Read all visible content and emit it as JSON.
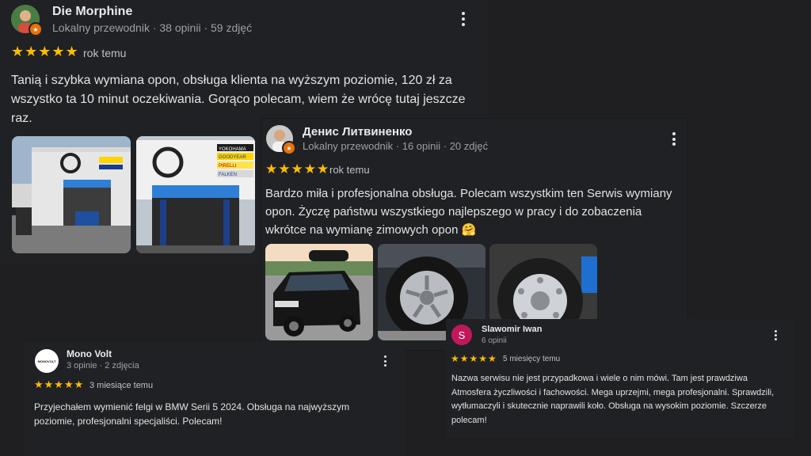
{
  "reviews": [
    {
      "name": "Die Morphine",
      "meta": "Lokalny przewodnik · 38 opinii · 59 zdjęć",
      "stars": "★★★★★",
      "rating": 5,
      "time": "rok temu",
      "text": "Tanią i szybka wymiana opon, obsługa klienta na wyższym poziomie, 120 zł za wszystko ta 10 minut oczekiwania. Gorąco polecam, wiem że wrócę tutaj jeszcze raz."
    },
    {
      "name": "Денис Литвиненко",
      "meta": "Lokalny przewodnik · 16 opinii · 20 zdjęć",
      "stars": "★★★★★",
      "rating": 5,
      "time": "rok temu",
      "text": "Bardzo miła i profesjonalna obsługa. Polecam wszystkim ten Serwis wymiany opon. Życzę państwu wszystkiego najlepszego w pracy i do zobaczenia wkrótce na wymianę zimowych opon 🤗"
    },
    {
      "name": "Mono Volt",
      "meta": "3 opinie · 2 zdjęcia",
      "avatar_text": "MONOVOLT",
      "stars": "★★★★★",
      "rating": 5,
      "time": "3 miesiące temu",
      "text": "Przyjechałem wymienić felgi w BMW Serii 5 2024. Obsługa na najwyższym poziomie, profesjonalni specjaliści. Polecam!"
    },
    {
      "name": "Slawomir Iwan",
      "meta": "6 opinii",
      "avatar_letter": "S",
      "stars": "★★★★★",
      "rating": 5,
      "time": "5 miesięcy temu",
      "text": "Nazwa serwisu nie jest przypadkowa i wiele o nim mówi. Tam jest prawdziwa Atmosfera życzliwości i fachowości. Mega uprzejmi, mega profesjonalni. Sprawdzili, wytłumaczyli i skutecznie naprawili koło. Obsługa na wysokim poziomie. Szczerze polecam!"
    }
  ],
  "photo_signs": {
    "yokohama": "YOKOHAMA",
    "goodyear": "GOODYEAR",
    "pirelli": "PIRELLI",
    "falken": "FALKEN"
  },
  "colors": {
    "background": "#1f1f21",
    "star": "#fbbc04",
    "guide_badge": "#e8710a",
    "avatar_s": "#c2185b"
  }
}
